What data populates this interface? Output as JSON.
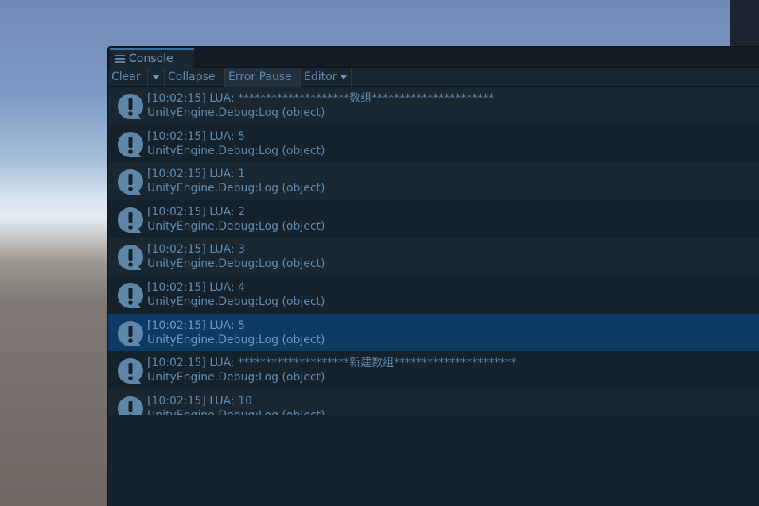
{
  "console": {
    "tab_label": "Console",
    "toolbar": {
      "clear": "Clear",
      "collapse": "Collapse",
      "error_pause": "Error Pause",
      "editor": "Editor"
    },
    "entries": [
      {
        "line1": "[10:02:15] LUA: ********************数组**********************",
        "line2": "UnityEngine.Debug:Log (object)"
      },
      {
        "line1": "[10:02:15] LUA: 5",
        "line2": "UnityEngine.Debug:Log (object)"
      },
      {
        "line1": "[10:02:15] LUA: 1",
        "line2": "UnityEngine.Debug:Log (object)"
      },
      {
        "line1": "[10:02:15] LUA: 2",
        "line2": "UnityEngine.Debug:Log (object)"
      },
      {
        "line1": "[10:02:15] LUA: 3",
        "line2": "UnityEngine.Debug:Log (object)"
      },
      {
        "line1": "[10:02:15] LUA: 4",
        "line2": "UnityEngine.Debug:Log (object)"
      },
      {
        "line1": "[10:02:15] LUA: 5",
        "line2": "UnityEngine.Debug:Log (object)",
        "selected": true
      },
      {
        "line1": "[10:02:15] LUA: ********************新建数组**********************",
        "line2": "UnityEngine.Debug:Log (object)"
      },
      {
        "line1": "[10:02:15] LUA: 10",
        "line2": "UnityEngine.Debug:Log (object)"
      }
    ],
    "entry_icon": "info-message-icon",
    "colors": {
      "accent": "#3a6f9e",
      "text": "#5f88ab",
      "selected_row": "#0f3a67",
      "icon": "#5e86a8"
    }
  }
}
